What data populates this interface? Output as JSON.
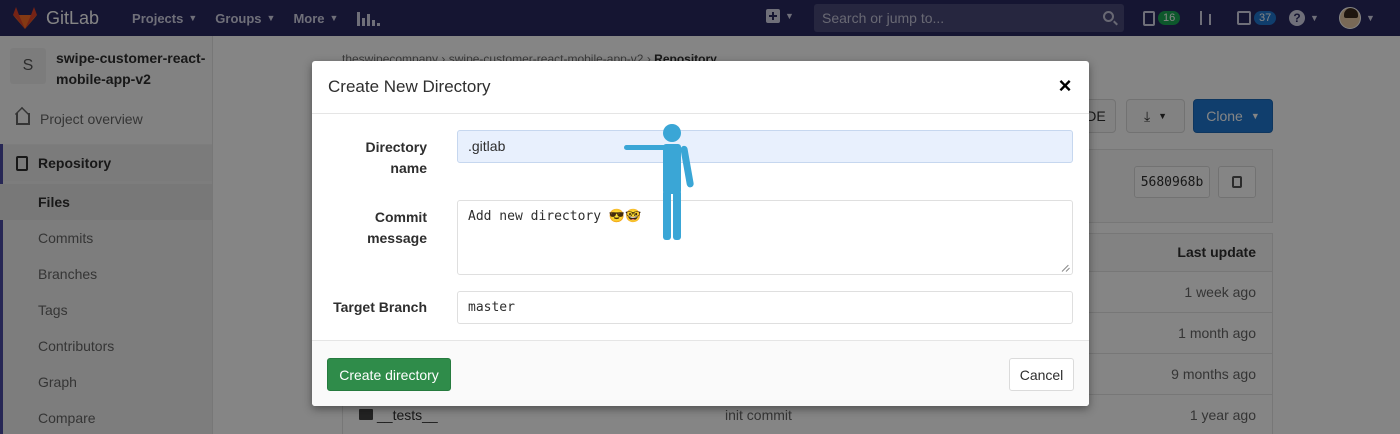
{
  "navbar": {
    "brand": "GitLab",
    "menu": [
      {
        "label": "Projects"
      },
      {
        "label": "Groups"
      },
      {
        "label": "More"
      }
    ],
    "search_placeholder": "Search or jump to...",
    "todo_count": "16",
    "issues_count": "37",
    "help_label": "?"
  },
  "sidebar": {
    "project_avatar": "S",
    "project_name": "swipe-customer-react-mobile-app-v2",
    "items": [
      {
        "label": "Project overview"
      },
      {
        "label": "Repository"
      },
      {
        "label": "Files"
      },
      {
        "label": "Commits"
      },
      {
        "label": "Branches"
      },
      {
        "label": "Tags"
      },
      {
        "label": "Contributors"
      },
      {
        "label": "Graph"
      },
      {
        "label": "Compare"
      }
    ]
  },
  "main": {
    "breadcrumb": {
      "group": "theswipecompany",
      "sep1": "›",
      "project": "swipe-customer-react-mobile-app-v2",
      "sep2": "›",
      "current": "Repository"
    },
    "ide_label": "IDE",
    "clone_label": "Clone",
    "commit_sha": "5680968b",
    "table_header_last_update": "Last update",
    "rows": [
      {
        "name": "",
        "message": "",
        "updated": "1 week ago"
      },
      {
        "name": "",
        "message": "",
        "updated": "1 month ago"
      },
      {
        "name": "",
        "message": "",
        "updated": "9 months ago"
      },
      {
        "name": "__tests__",
        "message": "init commit",
        "updated": "1 year ago"
      }
    ]
  },
  "modal": {
    "title": "Create New Directory",
    "close_label": "×",
    "directory_name_label": "Directory name",
    "directory_name_value": ".gitlab",
    "commit_message_label": "Commit message",
    "commit_message_value": "Add new directory 😎🤓",
    "target_branch_label": "Target Branch",
    "target_branch_value": "master",
    "create_button": "Create directory",
    "cancel_button": "Cancel"
  },
  "colors": {
    "navbar_bg": "#292961",
    "primary_blue": "#1f78d1",
    "success_green": "#2f8c4a",
    "annotation_figure": "#3aa6d6"
  }
}
